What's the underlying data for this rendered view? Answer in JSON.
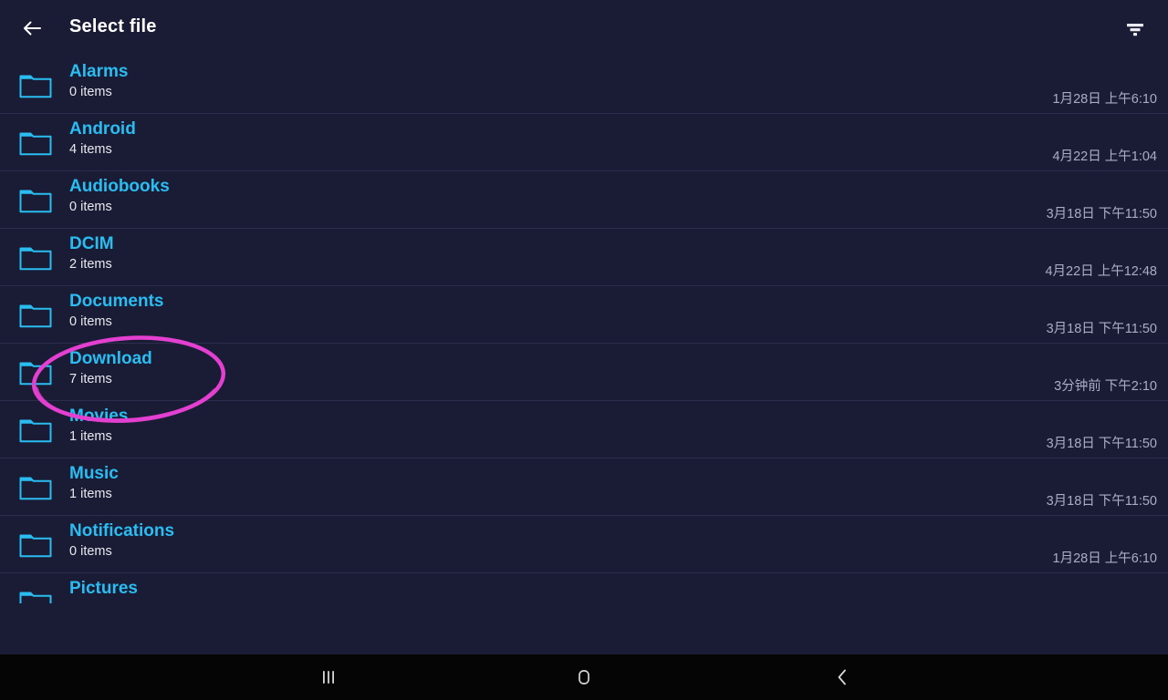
{
  "appbar": {
    "title": "Select file",
    "back_icon": "arrow-left-icon",
    "filter_icon": "filter-icon"
  },
  "files": [
    {
      "name": "Alarms",
      "count": "0 items",
      "date": "1月28日 上午6:10",
      "icon": "folder-icon",
      "annotated": false
    },
    {
      "name": "Android",
      "count": "4 items",
      "date": "4月22日 上午1:04",
      "icon": "folder-icon",
      "annotated": false
    },
    {
      "name": "Audiobooks",
      "count": "0 items",
      "date": "3月18日 下午11:50",
      "icon": "folder-icon",
      "annotated": false
    },
    {
      "name": "DCIM",
      "count": "2 items",
      "date": "4月22日 上午12:48",
      "icon": "folder-icon",
      "annotated": false
    },
    {
      "name": "Documents",
      "count": "0 items",
      "date": "3月18日 下午11:50",
      "icon": "folder-icon",
      "annotated": false
    },
    {
      "name": "Download",
      "count": "7 items",
      "date": "3分钟前 下午2:10",
      "icon": "folder-icon",
      "annotated": true
    },
    {
      "name": "Movies",
      "count": "1 items",
      "date": "3月18日 下午11:50",
      "icon": "folder-icon",
      "annotated": false
    },
    {
      "name": "Music",
      "count": "1 items",
      "date": "3月18日 下午11:50",
      "icon": "folder-icon",
      "annotated": false
    },
    {
      "name": "Notifications",
      "count": "0 items",
      "date": "1月28日 上午6:10",
      "icon": "folder-icon",
      "annotated": false
    },
    {
      "name": "Pictures",
      "count": "",
      "date": "",
      "icon": "folder-icon",
      "annotated": false
    }
  ],
  "annotation": {
    "shape": "ellipse",
    "target": "Download",
    "color": "#e33fd0"
  },
  "navbar": {
    "recents_icon": "recents-icon",
    "home_icon": "home-icon",
    "back_icon": "back-chevron-icon"
  },
  "colors": {
    "background": "#1a1c35",
    "folder_name": "#29bdf2",
    "divider": "#2b2e4d",
    "date_text": "#a9adc4",
    "navbar": "#050506",
    "annotation": "#e33fd0"
  }
}
